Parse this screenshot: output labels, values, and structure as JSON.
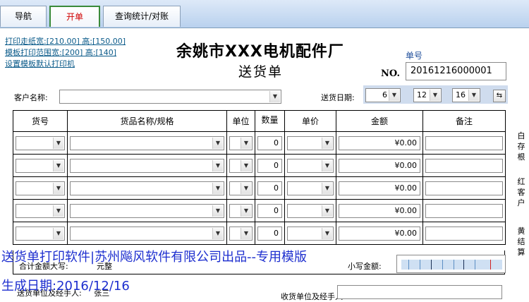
{
  "tabs": [
    {
      "label": "导航"
    },
    {
      "label": "开单"
    },
    {
      "label": "查询统计/对账"
    }
  ],
  "links": [
    "打印走纸宽:[210.00] 高:[150.00]",
    "模板打印范围宽:[200] 高:[140]",
    "设置模板默认打印机"
  ],
  "header": {
    "company": "余姚市XXX电机配件厂",
    "doc_title": "送货单",
    "no_caption": "单号",
    "no_label": "NO.",
    "no_value": "20161216000001"
  },
  "customer": {
    "label": "客户名称:",
    "value": ""
  },
  "date": {
    "label": "送货日期:",
    "year": "6",
    "month": "12",
    "day": "16",
    "swap_label": "⇆"
  },
  "columns": [
    "货号",
    "货品名称/规格",
    "单位",
    "数量",
    "单价",
    "金额",
    "备注"
  ],
  "rows": [
    {
      "qty": "0",
      "amount": "¥0.00"
    },
    {
      "qty": "0",
      "amount": "¥0.00"
    },
    {
      "qty": "0",
      "amount": "¥0.00"
    },
    {
      "qty": "0",
      "amount": "¥0.00"
    },
    {
      "qty": "0",
      "amount": "¥0.00"
    }
  ],
  "side": {
    "white": "白存根",
    "red": "红客户",
    "yellow": "黄结算"
  },
  "totals": {
    "label": "合计金额大写:",
    "upper_value": "元整",
    "small_label": "小写金额:"
  },
  "bottom": {
    "left_label": "送货单位及经手人:",
    "left_value": "张三",
    "right_label": "收货单位及经手人"
  },
  "watermark": {
    "line1": "送货单打印软件|苏州飚风软件有限公司出品--专用模版",
    "line2": "生成日期:2016/12/16"
  },
  "colors": {
    "link": "#0b5b8a",
    "watermark": "#1e2fcf",
    "active_tab_text": "#d00000",
    "active_tab_border": "#3a8a3a"
  }
}
